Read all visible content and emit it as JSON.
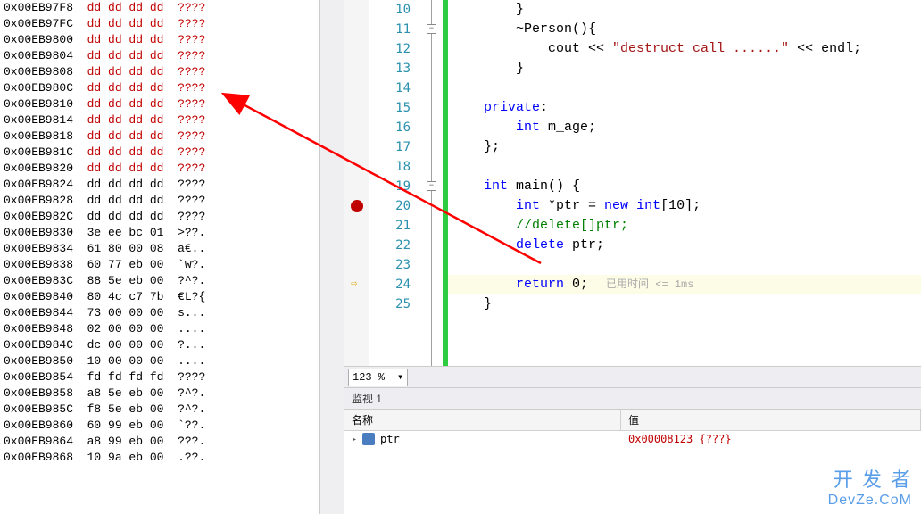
{
  "memory": {
    "rows": [
      {
        "addr": "0x00EB97F8",
        "hex": "dd dd dd dd",
        "asc": "????",
        "red": true
      },
      {
        "addr": "0x00EB97FC",
        "hex": "dd dd dd dd",
        "asc": "????",
        "red": true
      },
      {
        "addr": "0x00EB9800",
        "hex": "dd dd dd dd",
        "asc": "????",
        "red": true
      },
      {
        "addr": "0x00EB9804",
        "hex": "dd dd dd dd",
        "asc": "????",
        "red": true
      },
      {
        "addr": "0x00EB9808",
        "hex": "dd dd dd dd",
        "asc": "????",
        "red": true
      },
      {
        "addr": "0x00EB980C",
        "hex": "dd dd dd dd",
        "asc": "????",
        "red": true
      },
      {
        "addr": "0x00EB9810",
        "hex": "dd dd dd dd",
        "asc": "????",
        "red": true
      },
      {
        "addr": "0x00EB9814",
        "hex": "dd dd dd dd",
        "asc": "????",
        "red": true
      },
      {
        "addr": "0x00EB9818",
        "hex": "dd dd dd dd",
        "asc": "????",
        "red": true
      },
      {
        "addr": "0x00EB981C",
        "hex": "dd dd dd dd",
        "asc": "????",
        "red": true
      },
      {
        "addr": "0x00EB9820",
        "hex": "dd dd dd dd",
        "asc": "????",
        "red": true
      },
      {
        "addr": "0x00EB9824",
        "hex": "dd dd dd dd",
        "asc": "????",
        "red": false
      },
      {
        "addr": "0x00EB9828",
        "hex": "dd dd dd dd",
        "asc": "????",
        "red": false
      },
      {
        "addr": "0x00EB982C",
        "hex": "dd dd dd dd",
        "asc": "????",
        "red": false
      },
      {
        "addr": "0x00EB9830",
        "hex": "3e ee bc 01",
        "asc": ">??.",
        "red": false
      },
      {
        "addr": "0x00EB9834",
        "hex": "61 80 00 08",
        "asc": "a€..",
        "red": false
      },
      {
        "addr": "0x00EB9838",
        "hex": "60 77 eb 00",
        "asc": "`w?.",
        "red": false
      },
      {
        "addr": "0x00EB983C",
        "hex": "88 5e eb 00",
        "asc": "?^?.",
        "red": false
      },
      {
        "addr": "0x00EB9840",
        "hex": "80 4c c7 7b",
        "asc": "€L?{",
        "red": false
      },
      {
        "addr": "0x00EB9844",
        "hex": "73 00 00 00",
        "asc": "s...",
        "red": false
      },
      {
        "addr": "0x00EB9848",
        "hex": "02 00 00 00",
        "asc": "....",
        "red": false
      },
      {
        "addr": "0x00EB984C",
        "hex": "dc 00 00 00",
        "asc": "?...",
        "red": false
      },
      {
        "addr": "0x00EB9850",
        "hex": "10 00 00 00",
        "asc": "....",
        "red": false
      },
      {
        "addr": "0x00EB9854",
        "hex": "fd fd fd fd",
        "asc": "????",
        "red": false
      },
      {
        "addr": "0x00EB9858",
        "hex": "a8 5e eb 00",
        "asc": "?^?.",
        "red": false
      },
      {
        "addr": "0x00EB985C",
        "hex": "f8 5e eb 00",
        "asc": "?^?.",
        "red": false
      },
      {
        "addr": "0x00EB9860",
        "hex": "60 99 eb 00",
        "asc": "`??.",
        "red": false
      },
      {
        "addr": "0x00EB9864",
        "hex": "a8 99 eb 00",
        "asc": "???.",
        "red": false
      },
      {
        "addr": "0x00EB9868",
        "hex": "10 9a eb 00",
        "asc": ".??.",
        "red": false
      }
    ]
  },
  "code": {
    "line_start": 10,
    "breakpoint_line": 20,
    "current_line": 24,
    "lines": [
      {
        "n": 10,
        "html": "        }"
      },
      {
        "n": 11,
        "html": "        ~Person(){"
      },
      {
        "n": 12,
        "html": "            cout << <span class='str'>\"destruct call ......\"</span> << endl;"
      },
      {
        "n": 13,
        "html": "        }"
      },
      {
        "n": 14,
        "html": ""
      },
      {
        "n": 15,
        "html": "    <span class='kw'>private</span>:"
      },
      {
        "n": 16,
        "html": "        <span class='typ'>int</span> m_age;"
      },
      {
        "n": 17,
        "html": "    };"
      },
      {
        "n": 18,
        "html": ""
      },
      {
        "n": 19,
        "html": "    <span class='typ'>int</span> main() {"
      },
      {
        "n": 20,
        "html": "        <span class='typ'>int</span> *ptr = <span class='kw'>new</span> <span class='typ'>int</span>[10];"
      },
      {
        "n": 21,
        "html": "        <span class='com'>//delete[]ptr;</span>"
      },
      {
        "n": 22,
        "html": "        <span class='kw'>delete</span> ptr;"
      },
      {
        "n": 23,
        "html": ""
      },
      {
        "n": 24,
        "html": "        <span class='kw'>return</span> 0;<span class='perf-hint'>已用时间 &lt;= 1ms</span>",
        "hl": true
      },
      {
        "n": 25,
        "html": "    }"
      }
    ],
    "outline_boxes": [
      11,
      19
    ]
  },
  "zoom": {
    "value": "123 %"
  },
  "watch": {
    "title": "监视 1",
    "head_name": "名称",
    "head_value": "值",
    "rows": [
      {
        "name": "ptr",
        "value": "0x00008123 {???}"
      }
    ]
  },
  "watermark": {
    "line1": "开 发 者",
    "line2": "DevZe.CoM"
  }
}
